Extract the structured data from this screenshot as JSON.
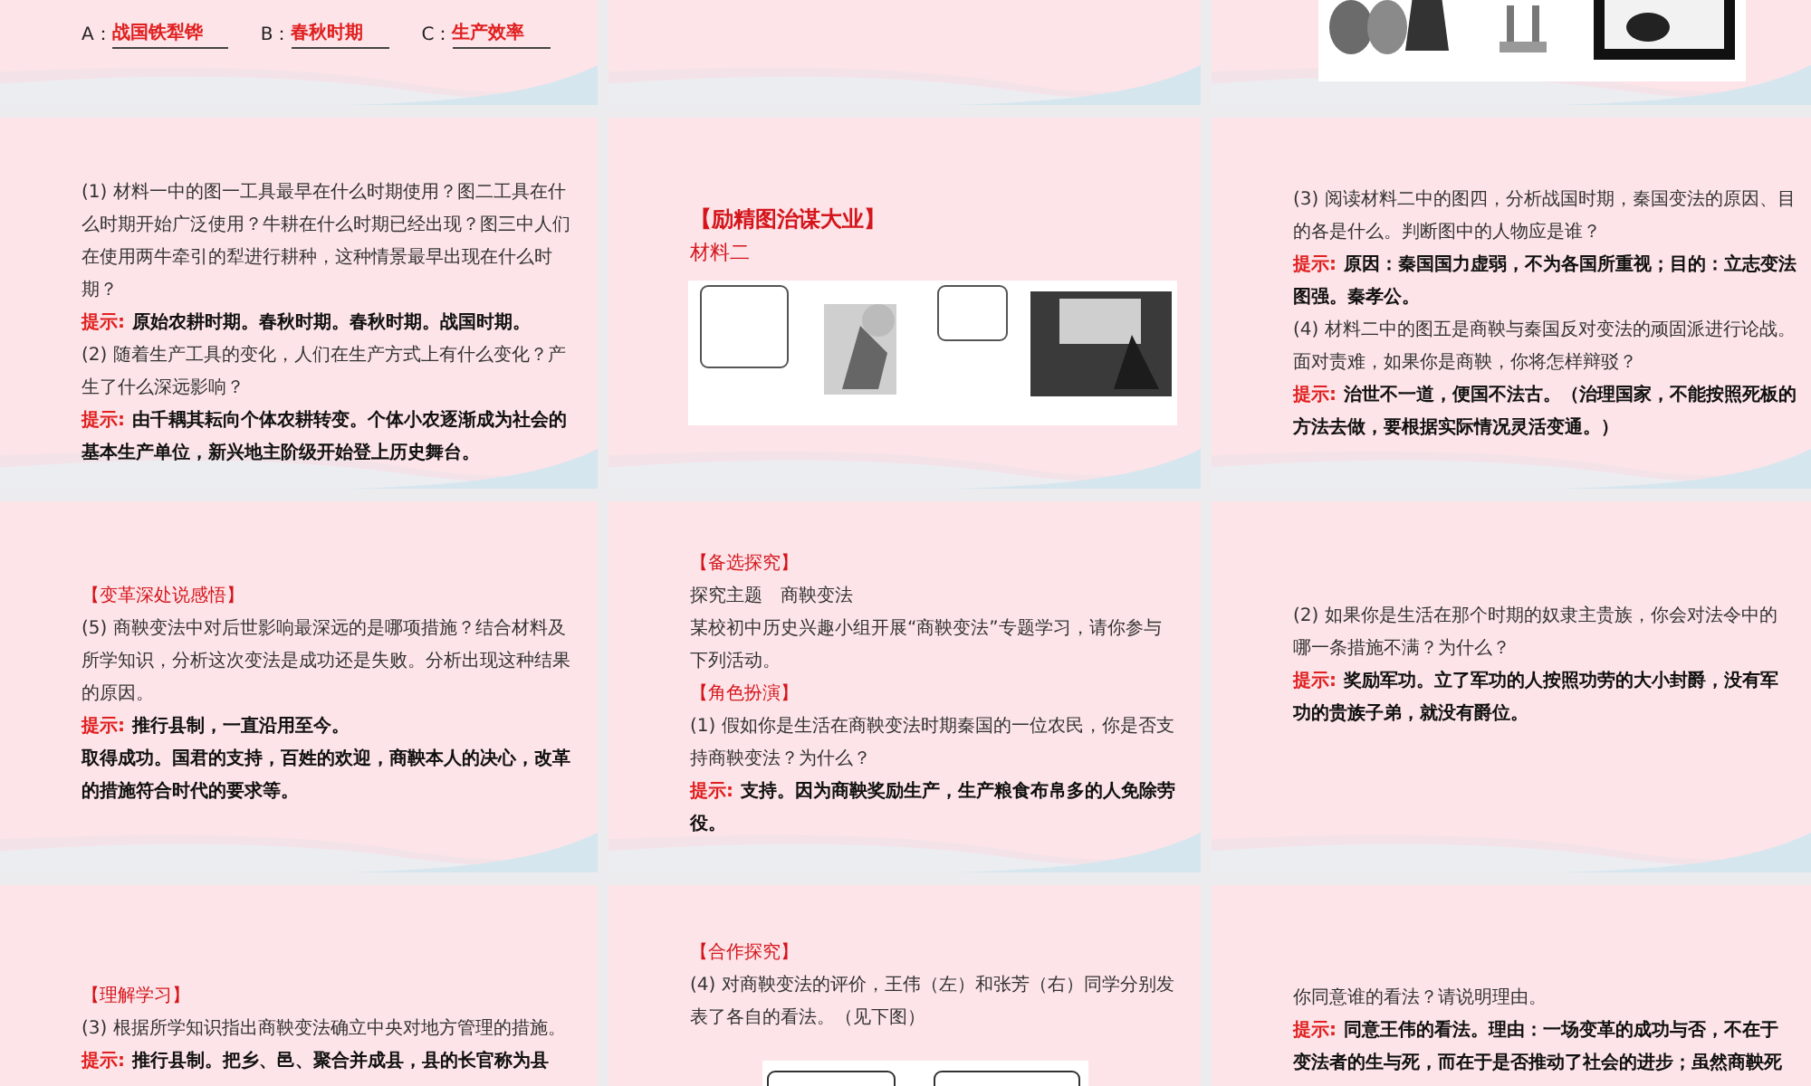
{
  "slides": [
    {
      "kind": "content",
      "blocks": [
        {
          "kind": "fill",
          "items": [
            {
              "label": "A：",
              "answer": "战国铁犁铧"
            },
            {
              "label": "B：",
              "answer": "春秋时期"
            },
            {
              "label": "C：",
              "answer": "生产效率"
            }
          ]
        }
      ]
    },
    {
      "kind": "blank"
    },
    {
      "kind": "content",
      "blocks": [
        {
          "kind": "picture"
        }
      ]
    },
    {
      "kind": "content",
      "blocks": [
        {
          "kind": "text",
          "text": "(1) 材料一中的图一工具最早在什么时期使用？图二工具在什么时期开始广泛使用？牛耕在什么时期已经出现？图三中人们在使用两牛牵引的犁进行耕种，这种情景最早出现在什么时期？"
        },
        {
          "kind": "hint",
          "label": "提示:",
          "text": "原始农耕时期。春秋时期。春秋时期。战国时期。"
        },
        {
          "kind": "text",
          "text": "(2) 随着生产工具的变化，人们在生产方式上有什么变化？产生了什么深远影响？"
        },
        {
          "kind": "hint",
          "label": "提示:",
          "text": "由千耦其耘向个体农耕转变。个体小农逐渐成为社会的基本生产单位，新兴地主阶级开始登上历史舞台。"
        }
      ]
    },
    {
      "kind": "content",
      "blocks": [
        {
          "kind": "title",
          "text": "【励精图治谋大业】"
        },
        {
          "kind": "subtitle",
          "text": "材料二"
        },
        {
          "kind": "picture"
        }
      ]
    },
    {
      "kind": "content",
      "blocks": [
        {
          "kind": "text",
          "text": "(3) 阅读材料二中的图四，分析战国时期，秦国变法的原因、目的各是什么。判断图中的人物应是谁？"
        },
        {
          "kind": "hint",
          "label": "提示:",
          "text": "原因：秦国国力虚弱，不为各国所重视；目的：立志变法图强。秦孝公。"
        },
        {
          "kind": "text",
          "text": "(4) 材料二中的图五是商鞅与秦国反对变法的顽固派进行论战。面对责难，如果你是商鞅，你将怎样辩驳？"
        },
        {
          "kind": "hint",
          "label": "提示:",
          "text": "治世不一道，便国不法古。（治理国家，不能按照死板的方法去做，要根据实际情况灵活变通。）"
        }
      ]
    },
    {
      "kind": "content",
      "blocks": [
        {
          "kind": "heading",
          "text": "【变革深处说感悟】"
        },
        {
          "kind": "text",
          "text": "(5) 商鞅变法中对后世影响最深远的是哪项措施？结合材料及所学知识，分析这次变法是成功还是失败。分析出现这种结果的原因。"
        },
        {
          "kind": "hint",
          "label": "提示:",
          "text": "推行县制，一直沿用至今。"
        },
        {
          "kind": "answer",
          "text": "取得成功。国君的支持，百姓的欢迎，商鞅本人的决心，改革的措施符合时代的要求等。"
        }
      ]
    },
    {
      "kind": "content",
      "blocks": [
        {
          "kind": "heading",
          "text": "【备选探究】"
        },
        {
          "kind": "text",
          "text": "探究主题　商鞅变法"
        },
        {
          "kind": "text",
          "text": "某校初中历史兴趣小组开展“商鞅变法”专题学习，请你参与下列活动。"
        },
        {
          "kind": "heading",
          "text": "【角色扮演】"
        },
        {
          "kind": "text",
          "text": "(1) 假如你是生活在商鞅变法时期秦国的一位农民，你是否支持商鞅变法？为什么？"
        },
        {
          "kind": "hint",
          "label": "提示:",
          "text": "支持。因为商鞅奖励生产，生产粮食布帛多的人免除劳役。"
        }
      ]
    },
    {
      "kind": "content",
      "blocks": [
        {
          "kind": "text",
          "text": "(2) 如果你是生活在那个时期的奴隶主贵族，你会对法令中的哪一条措施不满？为什么？"
        },
        {
          "kind": "hint",
          "label": "提示:",
          "text": "奖励军功。立了军功的人按照功劳的大小封爵，没有军功的贵族子弟，就没有爵位。"
        }
      ]
    },
    {
      "kind": "content",
      "blocks": [
        {
          "kind": "heading",
          "text": "【理解学习】"
        },
        {
          "kind": "text",
          "text": "(3) 根据所学知识指出商鞅变法确立中央对地方管理的措施。"
        },
        {
          "kind": "hint",
          "label": "提示:",
          "text": "推行县制。把乡、邑、聚合并成县，县的长官称为县"
        }
      ]
    },
    {
      "kind": "content",
      "blocks": [
        {
          "kind": "heading",
          "text": "【合作探究】"
        },
        {
          "kind": "text",
          "text": "(4) 对商鞅变法的评价，王伟（左）和张芳（右）同学分别发表了各自的看法。（见下图）"
        },
        {
          "kind": "picture"
        }
      ]
    },
    {
      "kind": "content",
      "blocks": [
        {
          "kind": "text",
          "text": "你同意谁的看法？请说明理由。"
        },
        {
          "kind": "hint",
          "label": "提示:",
          "text": "同意王伟的看法。理由：一场变革的成功与否，不在于变法者的生与死，而在于是否推动了社会的进步；虽然商鞅死"
        }
      ]
    }
  ]
}
